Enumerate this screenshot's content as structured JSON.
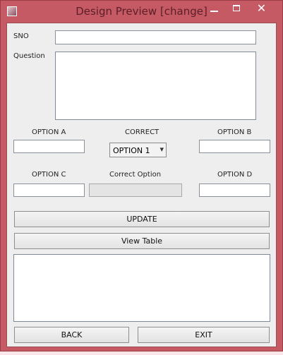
{
  "window": {
    "title": "Design Preview [change]",
    "close_glyph": "✕"
  },
  "labels": {
    "sno": "SNO",
    "question": "Question",
    "option_a": "OPTION A",
    "correct": "CORRECT",
    "option_b": "OPTION B",
    "option_c": "OPTION C",
    "correct_option": "Correct Option",
    "option_d": "OPTION D"
  },
  "fields": {
    "sno": "",
    "question": "",
    "option_a": "",
    "option_b": "",
    "option_c": "",
    "correct_option": "",
    "option_d": "",
    "output": ""
  },
  "correct_select": {
    "selected": "OPTION 1",
    "arrow": "▾"
  },
  "buttons": {
    "update": "UPDATE",
    "view_table": "View Table",
    "back": "BACK",
    "exit": "EXIT"
  }
}
